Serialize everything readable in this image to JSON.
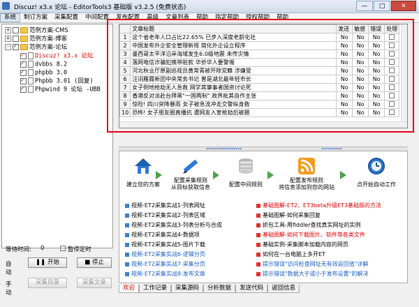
{
  "window": {
    "title": "Discuz! x3.x 论坛 - EditorTools3 基础版 v3.2.5 (免费状态)",
    "minimize": "—",
    "maximize": "□",
    "close": "✕"
  },
  "menu": [
    "系统",
    "制订方案",
    "采集配置",
    "中间配置",
    "发布配置",
    "高级",
    "文章列表",
    "帮助",
    "指定帮助",
    "授权帮助",
    "帮助"
  ],
  "tree": {
    "items": [
      {
        "label": "范例方案-CMS",
        "type": "folder",
        "expander": "+"
      },
      {
        "label": "范例方案-博客",
        "type": "folder",
        "expander": "+"
      },
      {
        "label": "范例方案-论坛",
        "type": "folder",
        "expander": "-"
      },
      {
        "label": "Discuz! x3.x 论坛",
        "type": "doc",
        "highlight": true
      },
      {
        "label": "dvbbs 8.2",
        "type": "doc"
      },
      {
        "label": "phpbb 3.0",
        "type": "doc"
      },
      {
        "label": "Phpbb 3.01 (回复)",
        "type": "doc"
      },
      {
        "label": "Phpwind 9 论坛 -UBB",
        "type": "doc"
      }
    ]
  },
  "grid": {
    "headers": [
      "文章标题",
      "发送",
      "敏感",
      "错误",
      "处理"
    ],
    "rows": [
      {
        "n": "1",
        "title": "这个省老年人口占比22.65% 已步入深度老龄化社",
        "send": "No",
        "sens": "No",
        "err": "No"
      },
      {
        "n": "2",
        "title": "中国发布外企安全管理新规 简化外企设立程序",
        "send": "No",
        "sens": "No",
        "err": "No"
      },
      {
        "n": "3",
        "title": "墨西哥太平洋沿岸海域发生6.0级地震 未传灾情",
        "send": "No",
        "sens": "No",
        "err": "No"
      },
      {
        "n": "4",
        "title": "落网电信诈骗犯携带赃款 华侨华人要警惕",
        "send": "No",
        "sens": "No",
        "err": "No"
      },
      {
        "n": "5",
        "title": "河北秋业厅原副巡视员黄常青被开除党籍 涉嫌受",
        "send": "No",
        "sens": "No",
        "err": "No"
      },
      {
        "n": "6",
        "title": "汪诩雁履新团中央常务书记 曾是湖北最年轻市长",
        "send": "No",
        "sens": "No",
        "err": "No"
      },
      {
        "n": "7",
        "title": "女子倒地抢劫无人急救 网学其肇事者国资讨论死",
        "send": "No",
        "sens": "No",
        "err": "No"
      },
      {
        "n": "8",
        "title": "香港反对派赴台拜黑\"一国两制\" 政界批其自作主张",
        "send": "No",
        "sens": "No",
        "err": "No"
      },
      {
        "n": "9",
        "title": "惊险! 四川突降暴雨 女子被急流冲走交警纵身救",
        "send": "No",
        "sens": "No",
        "err": "No"
      },
      {
        "n": "10",
        "title": "恐怖! 女子朋友圈直播抗 遭网友入室抢劫后被捆",
        "send": "No",
        "sens": "No",
        "err": "No"
      }
    ]
  },
  "flow": [
    {
      "label1": "建立您的方案",
      "label2": ""
    },
    {
      "label1": "配置采集规则",
      "label2": "从目标获取信息"
    },
    {
      "label1": "配置中间规则",
      "label2": ""
    },
    {
      "label1": "配置发布规则",
      "label2": "将信息添加到您的网站"
    },
    {
      "label1": "点开始自动工作",
      "label2": ""
    }
  ],
  "links_left": [
    "视频-ET2采集实战1-列表网址",
    "视频-ET2采集实战2-列表区域",
    "视频-ET2采集实战3-列表分析与合成",
    "视频-ET2采集实战4-数据项",
    "视频-ET2采集实战5-图片下载",
    "视频-ET2采集实战6-逻辑分页",
    "视频-ET2采集实战7-采集分页",
    "视频-ET2采集实战8-发布文章"
  ],
  "links_right": [
    "基础图解-ET2、ET3beta升级ET3基础版的方法",
    "基础图解-如何采集回复",
    "抓包工具-用fiddler查找真实网址的实例",
    "基础图解-如何下载图片、软件等各类文件",
    "基础实例-采集脚本加载内容的网页",
    "如何在一台电脑上多开ET",
    "提示错误\"访问检查网址无有效返回值\"详解",
    "提示错误\"数据大于或小于发布设置\"的解决"
  ],
  "bottom_tabs": [
    "欢迎",
    "工作记录",
    "采集源码",
    "分析数据",
    "发送代码",
    "返回信息"
  ],
  "controls": {
    "wait_label": "等待时间:",
    "wait_value": "0",
    "pause_label": "暂停定时",
    "auto_label": "自动",
    "start": "开始",
    "stop": "停止",
    "manual_label": "手动",
    "collect_list": "采集目录",
    "collect_article": "采集文章"
  }
}
